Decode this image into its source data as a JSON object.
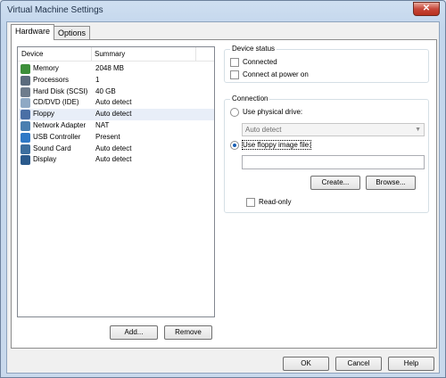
{
  "window": {
    "title": "Virtual Machine Settings",
    "close_glyph": "✕"
  },
  "tabs": [
    {
      "label": "Hardware"
    },
    {
      "label": "Options"
    }
  ],
  "device_list": {
    "columns": {
      "device": "Device",
      "summary": "Summary"
    },
    "rows": [
      {
        "device": "Memory",
        "summary": "2048 MB",
        "icon": "memory-icon",
        "color": "#3d8f3a"
      },
      {
        "device": "Processors",
        "summary": "1",
        "icon": "processor-icon",
        "color": "#5b6b7d"
      },
      {
        "device": "Hard Disk (SCSI)",
        "summary": "40 GB",
        "icon": "hard-disk-icon",
        "color": "#6e7c8c"
      },
      {
        "device": "CD/DVD (IDE)",
        "summary": "Auto detect",
        "icon": "cd-dvd-icon",
        "color": "#8fa9c4"
      },
      {
        "device": "Floppy",
        "summary": "Auto detect",
        "icon": "floppy-icon",
        "color": "#4a6fa5",
        "selected": true
      },
      {
        "device": "Network Adapter",
        "summary": "NAT",
        "icon": "network-adapter-icon",
        "color": "#4a7fb0"
      },
      {
        "device": "USB Controller",
        "summary": "Present",
        "icon": "usb-icon",
        "color": "#2f79c6"
      },
      {
        "device": "Sound Card",
        "summary": "Auto detect",
        "icon": "sound-card-icon",
        "color": "#3c6e9e"
      },
      {
        "device": "Display",
        "summary": "Auto detect",
        "icon": "display-icon",
        "color": "#2b5a8c"
      }
    ]
  },
  "list_buttons": {
    "add": "Add...",
    "remove": "Remove"
  },
  "device_status": {
    "title": "Device status",
    "connected": {
      "label": "Connected",
      "checked": false
    },
    "connect_at_power_on": {
      "label": "Connect at power on",
      "checked": false
    }
  },
  "connection": {
    "title": "Connection",
    "physical_drive": {
      "label": "Use physical drive:",
      "selected": false,
      "value": "Auto detect"
    },
    "image_file": {
      "label": "Use floppy image file:",
      "selected": true,
      "value": ""
    },
    "create": "Create...",
    "browse": "Browse...",
    "read_only": {
      "label": "Read-only",
      "checked": false
    }
  },
  "footer": {
    "ok": "OK",
    "cancel": "Cancel",
    "help": "Help"
  }
}
